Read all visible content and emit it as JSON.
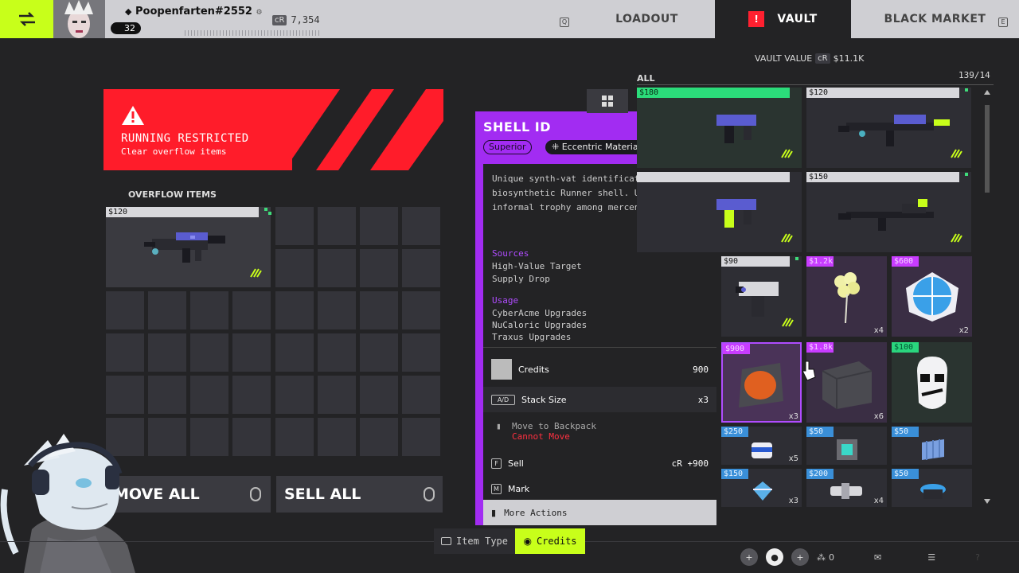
{
  "topbar": {
    "player_name": "Poopenfarten#2552",
    "level": "32",
    "credits_label": "cR",
    "credits": "7,354",
    "tabs": [
      {
        "label": "LOADOUT",
        "key": "Q"
      },
      {
        "label": "VAULT"
      },
      {
        "label": "BLACK MARKET",
        "key": "E"
      }
    ]
  },
  "banner": {
    "title": "RUNNING RESTRICTED",
    "subtitle": "Clear overflow items"
  },
  "overflow": {
    "title": "OVERFLOW ITEMS",
    "item_price": "$120"
  },
  "buttons": {
    "move_all": "MOVE ALL",
    "sell_all": "SELL ALL"
  },
  "tooltip": {
    "title": "SHELL ID",
    "count": "x3",
    "tag_rarity": "Superior",
    "tag_type": "Eccentric Material",
    "description": "Unique synth-vat identification for each biosynthetic Runner shell. Used as an informal trophy among mercenaries.",
    "sources_title": "Sources",
    "sources": [
      "High-Value Target",
      "Supply Drop"
    ],
    "usage_title": "Usage",
    "usage": [
      "CyberAcme Upgrades",
      "NuCaloric Upgrades",
      "Traxus Upgrades"
    ],
    "credits_label": "Credits",
    "credits_value": "900",
    "stack_key": "A/D",
    "stack_label": "Stack Size",
    "stack_value": "x3",
    "move_label": "Move to Backpack",
    "move_warning": "Cannot Move",
    "sell_key": "F",
    "sell_label": "Sell",
    "sell_value": "cR +900",
    "mark_key": "M",
    "mark_label": "Mark",
    "more_label": "More Actions"
  },
  "vault": {
    "value_label": "VAULT VALUE",
    "value_cr": "cR",
    "value": "$11.1K",
    "filter_label": "ALL",
    "count": "139/14",
    "slots": [
      {
        "price": "$180",
        "qty": ""
      },
      {
        "price": "$120",
        "qty": ""
      },
      {
        "price": "",
        "qty": ""
      },
      {
        "price": "$150",
        "qty": ""
      },
      {
        "price": "$90",
        "qty": ""
      },
      {
        "price": "$1.2k",
        "qty": "x4"
      },
      {
        "price": "$600",
        "qty": "x2"
      },
      {
        "price": "$900",
        "qty": "x3"
      },
      {
        "price": "$1.8k",
        "qty": "x6"
      },
      {
        "price": "$100",
        "qty": ""
      },
      {
        "price": "$250",
        "qty": "x5"
      },
      {
        "price": "$50",
        "qty": ""
      },
      {
        "price": "$50",
        "qty": ""
      },
      {
        "price": "$150",
        "qty": "x3"
      },
      {
        "price": "$200",
        "qty": "x4"
      },
      {
        "price": "$50",
        "qty": ""
      }
    ]
  },
  "bottom": {
    "item_type": "Item Type",
    "credits": "Credits",
    "party_count": "0"
  },
  "colors": {
    "accent_lime": "#c8ff1a",
    "warning_red": "#ff1c2a",
    "superior_purple": "#a22cf2"
  }
}
